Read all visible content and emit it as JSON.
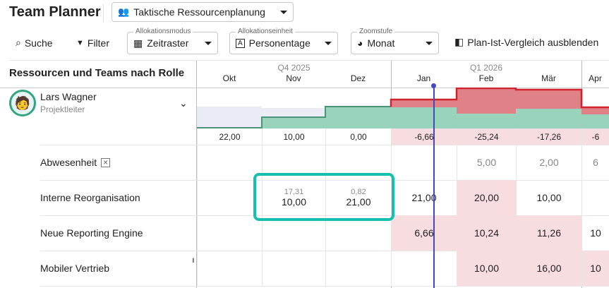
{
  "header": {
    "title": "Team Planner",
    "view_select": "Taktische Ressourcenplanung"
  },
  "toolbar": {
    "search": "Suche",
    "filter": "Filter",
    "alloc_mode": {
      "label": "Allokationsmodus",
      "value": "Zeitraster"
    },
    "alloc_unit": {
      "label": "Allokationseinheit",
      "value": "Personentage"
    },
    "zoom": {
      "label": "Zoomstufe",
      "value": "Monat"
    },
    "compare": "Plan-Ist-Vergleich ausblenden"
  },
  "left_header": "Ressourcen und Teams nach Rolle",
  "quarters": [
    "Q4 2025",
    "Q1 2026"
  ],
  "months": [
    "Okt",
    "Nov",
    "Dez",
    "Jan",
    "Feb",
    "Mär",
    "Apr"
  ],
  "person": {
    "name": "Lars Wagner",
    "role": "Projektleiter",
    "balance": [
      "22,00",
      "10,00",
      "0,00",
      "-6,66",
      "-25,24",
      "-17,26",
      "-6"
    ]
  },
  "rows": [
    {
      "label": "Abwesenheit",
      "values": [
        "",
        "",
        "",
        "",
        "5,00",
        "2,00",
        "6"
      ]
    },
    {
      "label": "Interne Reorganisation",
      "values": [
        "",
        "10,00",
        "21,00",
        "21,00",
        "20,00",
        "10,00",
        ""
      ],
      "actuals": [
        "",
        "17,31",
        "0,82",
        "",
        "",
        "",
        ""
      ]
    },
    {
      "label": "Neue Reporting Engine",
      "values": [
        "",
        "",
        "",
        "6,66",
        "10,24",
        "11,26",
        "10"
      ]
    },
    {
      "label": "Mobiler Vertrieb",
      "values": [
        "",
        "",
        "",
        "",
        "10,00",
        "16,00",
        "10"
      ]
    }
  ],
  "colors": {
    "capacity": "#9ad3bb",
    "over": "#df8186",
    "over_line": "#d0232e",
    "highlight": "#16bfae",
    "today": "#4447c4",
    "pink": "#f7dde0"
  }
}
